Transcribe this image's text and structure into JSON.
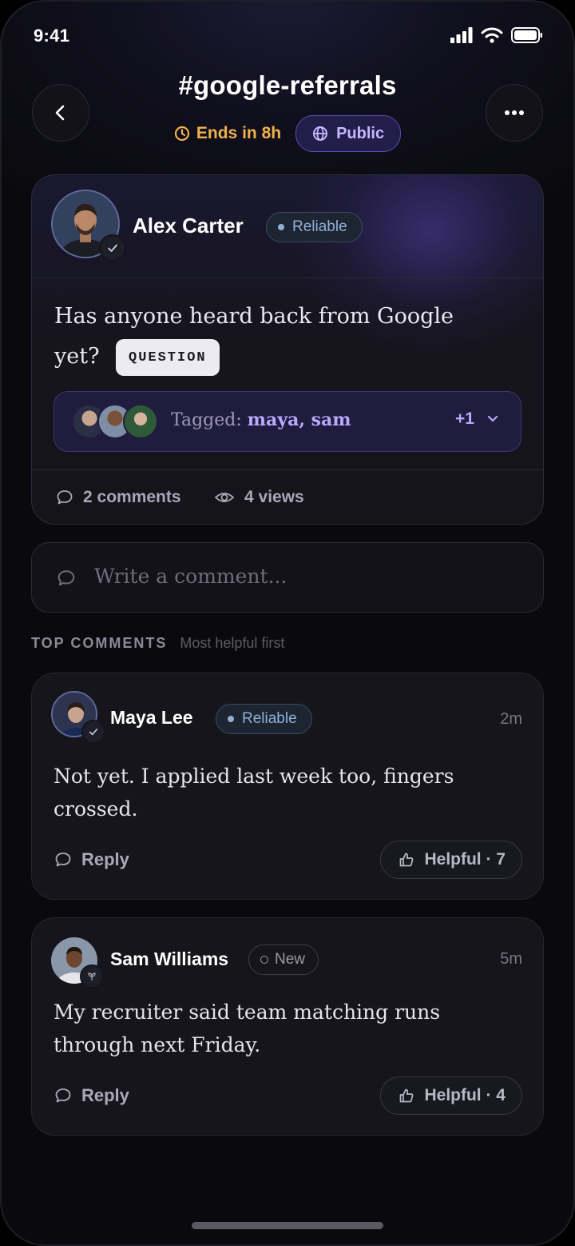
{
  "status_bar": {
    "time": "9:41"
  },
  "header": {
    "title": "#google-referrals",
    "ends_text": "Ends in 8h",
    "visibility": "Public"
  },
  "post": {
    "author": "Alex Carter",
    "author_badge": "Reliable",
    "text": "Has anyone heard back from Google yet?",
    "tag": "QUESTION",
    "tagged_prefix": "Tagged:",
    "tagged_names": "maya, sam",
    "tagged_more": "+1",
    "comments_count": "2 comments",
    "views_count": "4 views"
  },
  "comment_input": {
    "placeholder": "Write a comment..."
  },
  "section": {
    "title": "TOP COMMENTS",
    "subtitle": "Most helpful first"
  },
  "comments": [
    {
      "author": "Maya Lee",
      "badge": "Reliable",
      "time": "2m",
      "text": "Not yet. I applied last week too, fingers crossed.",
      "reply_label": "Reply",
      "helpful_label": "Helpful · 7"
    },
    {
      "author": "Sam Williams",
      "badge": "New",
      "time": "5m",
      "text": "My recruiter said team matching runs through next Friday.",
      "reply_label": "Reply",
      "helpful_label": "Helpful · 4"
    }
  ],
  "colors": {
    "background": "#0a0a0e",
    "accent_purple": "#b9a9ff",
    "ends_orange": "#f0b24e",
    "reliable_blue": "#8fb1d6"
  }
}
